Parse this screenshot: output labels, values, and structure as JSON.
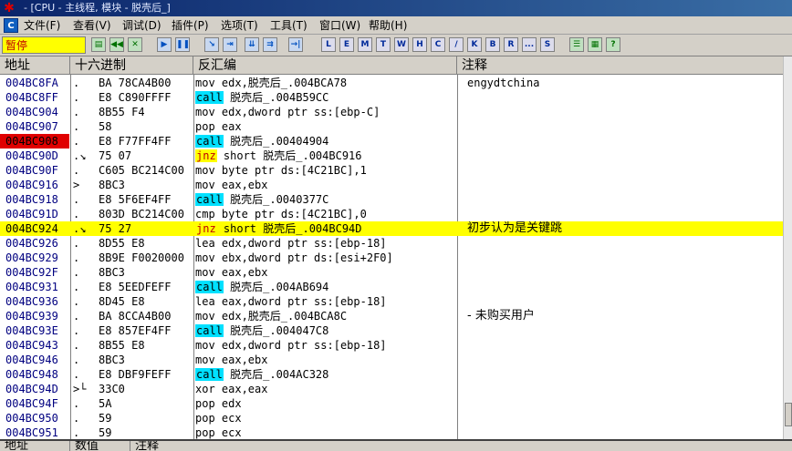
{
  "window": {
    "title": "- [CPU - 主线程, 模块 - 脱壳后_]"
  },
  "menu": [
    "文件(F)",
    "查看(V)",
    "调试(D)",
    "插件(P)",
    "选项(T)",
    "工具(T)",
    "窗口(W)",
    "帮助(H)"
  ],
  "status": "暂停",
  "toolbar_letters": [
    "L",
    "E",
    "M",
    "T",
    "W",
    "H",
    "C",
    "/",
    "K",
    "B",
    "R",
    "...",
    "S"
  ],
  "columns": {
    "addr": "地址",
    "hex": "十六进制",
    "asm": "反汇编",
    "comment": "注释"
  },
  "rows": [
    {
      "addr": "004BC8FA",
      "mark": ".",
      "hex": "BA 78CA4B00",
      "op": "",
      "asm": "mov edx,脱壳后_.004BCA78",
      "comment": "engydtchina"
    },
    {
      "addr": "004BC8FF",
      "mark": ".",
      "hex": "E8 C890FFFF",
      "op": "call",
      "asm": " 脱壳后_.004B59CC",
      "comment": ""
    },
    {
      "addr": "004BC904",
      "mark": ".",
      "hex": "8B55 F4",
      "op": "",
      "asm": "mov edx,dword ptr ss:[ebp-C]",
      "comment": ""
    },
    {
      "addr": "004BC907",
      "mark": ".",
      "hex": "58",
      "op": "",
      "asm": "pop eax",
      "comment": ""
    },
    {
      "addr": "004BC908",
      "mark": ".",
      "hex": "E8 F77FF4FF",
      "op": "call",
      "asm": " 脱壳后_.00404904",
      "comment": "",
      "bp": true
    },
    {
      "addr": "004BC90D",
      "mark": ".↘",
      "hex": "75 07",
      "op": "jnz",
      "asm": " short 脱壳后_.004BC916",
      "comment": ""
    },
    {
      "addr": "004BC90F",
      "mark": ".",
      "hex": "C605 BC214C00",
      "op": "",
      "asm": "mov byte ptr ds:[4C21BC],1",
      "comment": ""
    },
    {
      "addr": "004BC916",
      "mark": ">",
      "hex": "8BC3",
      "op": "",
      "asm": "mov eax,ebx",
      "comment": ""
    },
    {
      "addr": "004BC918",
      "mark": ".",
      "hex": "E8 5F6EF4FF",
      "op": "call",
      "asm": " 脱壳后_.0040377C",
      "comment": ""
    },
    {
      "addr": "004BC91D",
      "mark": ".",
      "hex": "803D BC214C00",
      "op": "",
      "asm": "cmp byte ptr ds:[4C21BC],0",
      "comment": ""
    },
    {
      "addr": "004BC924",
      "mark": ".↘",
      "hex": "75 27",
      "op": "jnz",
      "asm": " short 脱壳后_.004BC94D",
      "comment": "初步认为是关键跳",
      "hl": true
    },
    {
      "addr": "004BC926",
      "mark": ".",
      "hex": "8D55 E8",
      "op": "",
      "asm": "lea edx,dword ptr ss:[ebp-18]",
      "comment": ""
    },
    {
      "addr": "004BC929",
      "mark": ".",
      "hex": "8B9E F0020000",
      "op": "",
      "asm": "mov ebx,dword ptr ds:[esi+2F0]",
      "comment": ""
    },
    {
      "addr": "004BC92F",
      "mark": ".",
      "hex": "8BC3",
      "op": "",
      "asm": "mov eax,ebx",
      "comment": ""
    },
    {
      "addr": "004BC931",
      "mark": ".",
      "hex": "E8 5EEDFEFF",
      "op": "call",
      "asm": " 脱壳后_.004AB694",
      "comment": ""
    },
    {
      "addr": "004BC936",
      "mark": ".",
      "hex": "8D45 E8",
      "op": "",
      "asm": "lea eax,dword ptr ss:[ebp-18]",
      "comment": ""
    },
    {
      "addr": "004BC939",
      "mark": ".",
      "hex": "BA 8CCA4B00",
      "op": "",
      "asm": "mov edx,脱壳后_.004BCA8C",
      "comment": "  - 未购买用户"
    },
    {
      "addr": "004BC93E",
      "mark": ".",
      "hex": "E8 857EF4FF",
      "op": "call",
      "asm": " 脱壳后_.004047C8",
      "comment": ""
    },
    {
      "addr": "004BC943",
      "mark": ".",
      "hex": "8B55 E8",
      "op": "",
      "asm": "mov edx,dword ptr ss:[ebp-18]",
      "comment": ""
    },
    {
      "addr": "004BC946",
      "mark": ".",
      "hex": "8BC3",
      "op": "",
      "asm": "mov eax,ebx",
      "comment": ""
    },
    {
      "addr": "004BC948",
      "mark": ".",
      "hex": "E8 DBF9FEFF",
      "op": "call",
      "asm": " 脱壳后_.004AC328",
      "comment": ""
    },
    {
      "addr": "004BC94D",
      "mark": ">└",
      "hex": "33C0",
      "op": "",
      "asm": "xor eax,eax",
      "comment": ""
    },
    {
      "addr": "004BC94F",
      "mark": ".",
      "hex": "5A",
      "op": "",
      "asm": "pop edx",
      "comment": ""
    },
    {
      "addr": "004BC950",
      "mark": ".",
      "hex": "59",
      "op": "",
      "asm": "pop ecx",
      "comment": ""
    },
    {
      "addr": "004BC951",
      "mark": ".",
      "hex": "59",
      "op": "",
      "asm": "pop ecx",
      "comment": ""
    }
  ],
  "bottom_columns": {
    "addr": "地址",
    "data": "数值",
    "comment": "注释"
  },
  "colors": {
    "highlight": "#ffff00",
    "breakpoint": "#e00000",
    "call_bg": "#00e0ff",
    "jnz_fg": "#c00000"
  }
}
